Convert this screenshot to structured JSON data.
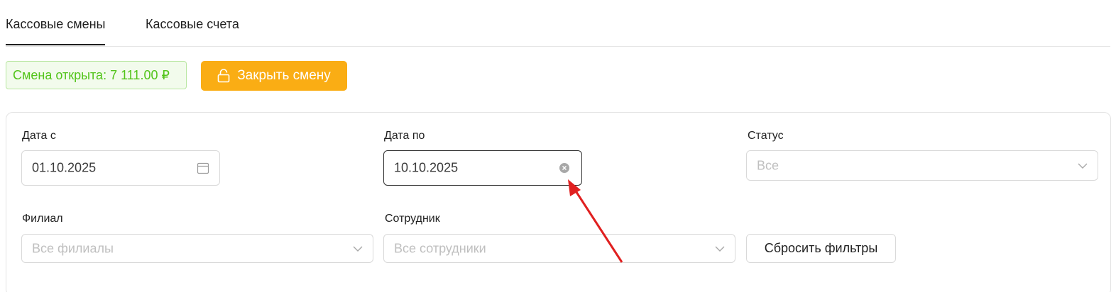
{
  "tabs": [
    {
      "label": "Кассовые смены",
      "active": true
    },
    {
      "label": "Кассовые счета",
      "active": false
    }
  ],
  "shift": {
    "status_text": "Смена открыта: 7 111.00 ₽",
    "close_label": "Закрыть смену",
    "close_icon": "lock-open-icon"
  },
  "filters": {
    "date_from": {
      "label": "Дата с",
      "value": "01.10.2025",
      "icon": "calendar-icon"
    },
    "date_to": {
      "label": "Дата по",
      "value": "10.10.2025",
      "icon": "clear-circle-icon"
    },
    "status": {
      "label": "Статус",
      "placeholder": "Все",
      "icon": "chevron-down-icon"
    },
    "branch": {
      "label": "Филиал",
      "placeholder": "Все филиалы",
      "icon": "chevron-down-icon"
    },
    "employee": {
      "label": "Сотрудник",
      "placeholder": "Все сотрудники",
      "icon": "chevron-down-icon"
    },
    "reset_label": "Сбросить фильтры"
  },
  "colors": {
    "accent": "#faad14",
    "success_text": "#52c41a",
    "success_bg": "#f2fbec",
    "annotation_arrow": "#e02020"
  }
}
